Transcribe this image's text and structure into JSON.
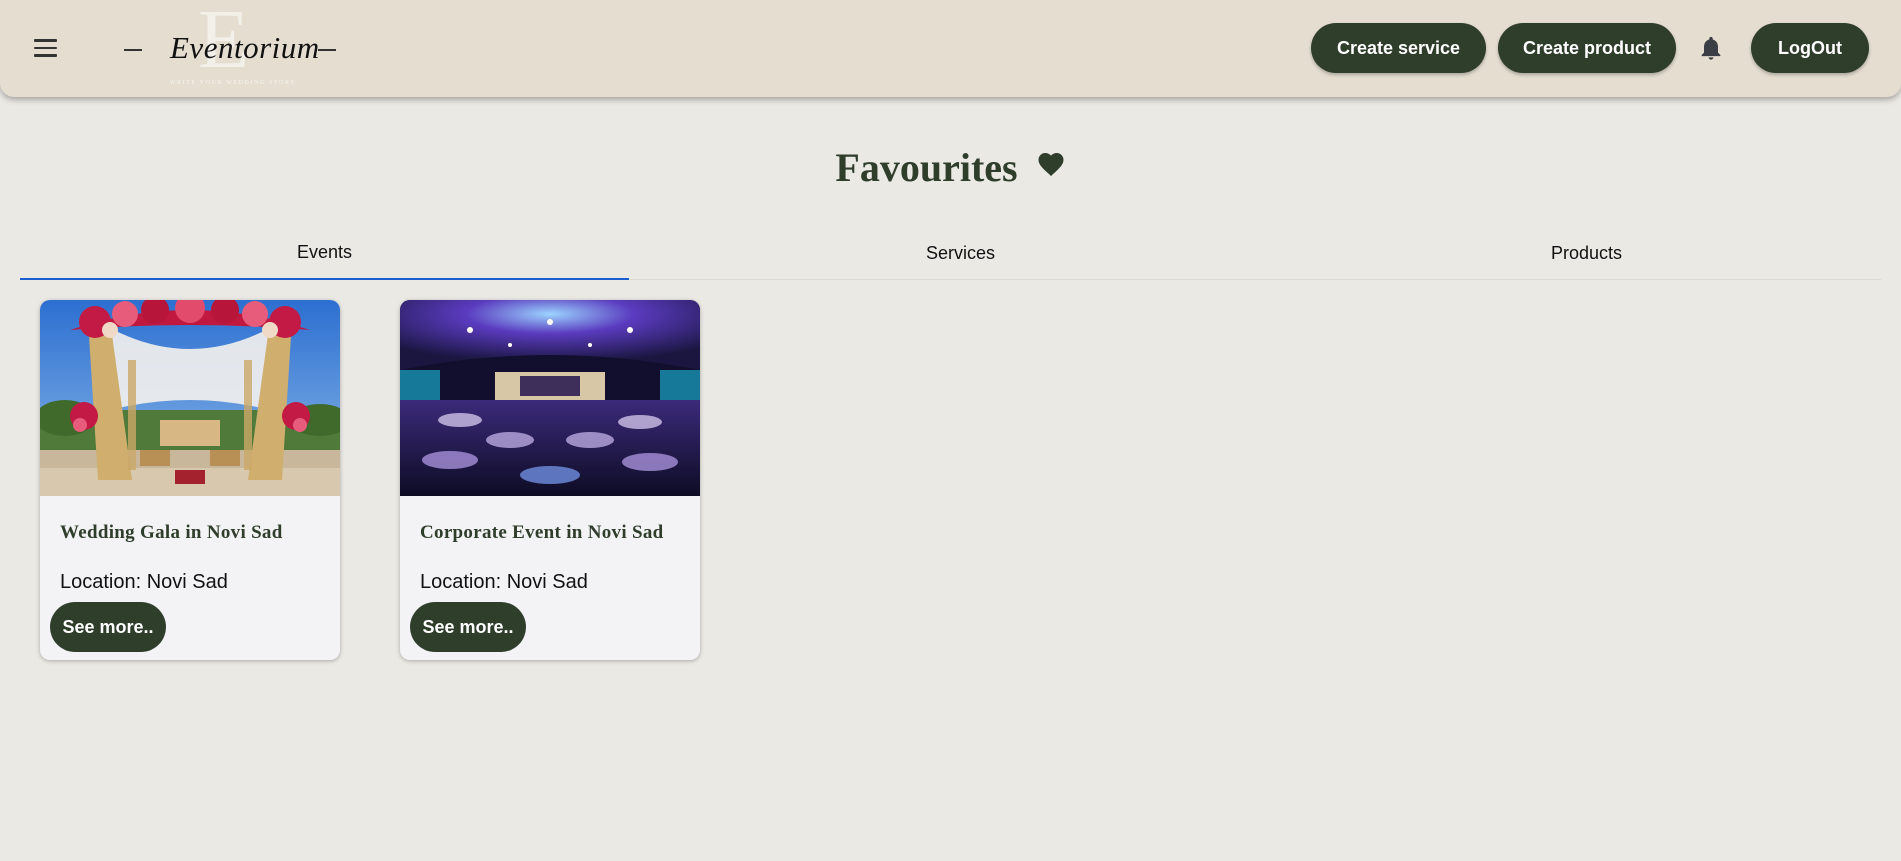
{
  "header": {
    "logo": {
      "wordmark": "Eventorium",
      "monogram": "E",
      "tagline": "WRITE YOUR WEDDING STORY"
    },
    "buttons": {
      "create_service": "Create service",
      "create_product": "Create product",
      "logout": "LogOut"
    },
    "icons": {
      "menu": "hamburger-menu-icon",
      "notifications": "bell-icon"
    }
  },
  "page": {
    "title": "Favourites",
    "title_icon": "heart-icon"
  },
  "tabs": [
    {
      "label": "Events",
      "active": true
    },
    {
      "label": "Services",
      "active": false
    },
    {
      "label": "Products",
      "active": false
    }
  ],
  "cards": [
    {
      "title": "Wedding Gala in Novi Sad",
      "location": "Location: Novi Sad",
      "button": "See more..",
      "image": "wedding mandap with floral canopy"
    },
    {
      "title": "Corporate Event in Novi Sad",
      "location": "Location: Novi Sad",
      "button": "See more..",
      "image": "ballroom with purple and blue lighting"
    }
  ],
  "colors": {
    "page_bg": "#ebe9e4",
    "header_bg": "#e4ddd0",
    "accent": "#2f3d2b",
    "tab_indicator": "#1a5fd0",
    "card_bg": "#f3f3f5"
  }
}
